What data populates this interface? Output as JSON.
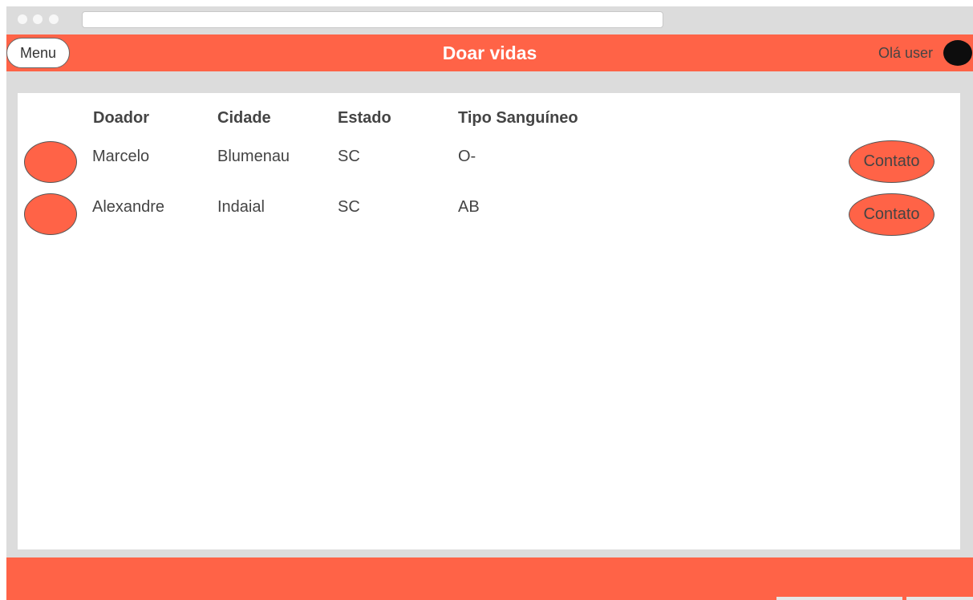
{
  "header": {
    "menu_label": "Menu",
    "title": "Doar vidas",
    "greeting": "Olá user"
  },
  "table": {
    "columns": [
      "Doador",
      "Cidade",
      "Estado",
      "Tipo Sanguíneo"
    ],
    "rows": [
      {
        "doador": "Marcelo",
        "cidade": "Blumenau",
        "estado": "SC",
        "tipo": "O-",
        "action": "Contato"
      },
      {
        "doador": "Alexandre",
        "cidade": "Indaial",
        "estado": "SC",
        "tipo": "AB",
        "action": "Contato"
      }
    ]
  },
  "colors": {
    "accent": "#ff6347",
    "frame": "#dcdcdc",
    "avatar": "#0d0d0d"
  }
}
